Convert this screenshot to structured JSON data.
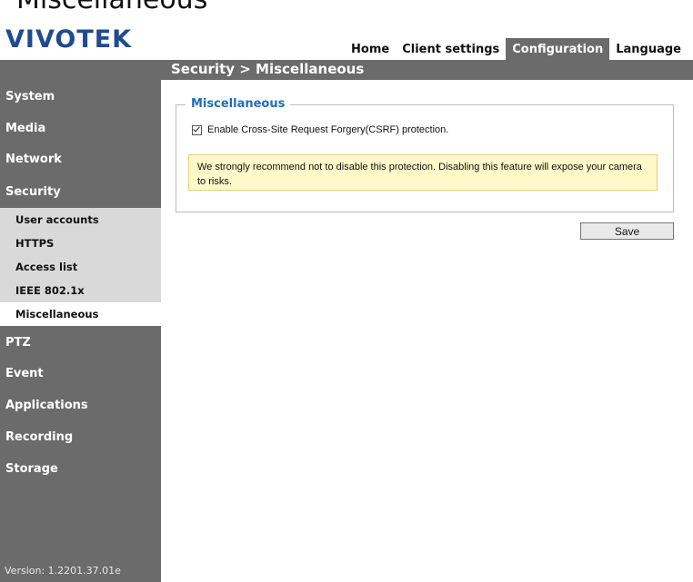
{
  "page_heading": "Miscellaneous",
  "logo": "VIVOTEK",
  "topnav": {
    "home": "Home",
    "client_settings": "Client settings",
    "configuration": "Configuration",
    "language": "Language"
  },
  "breadcrumb": "Security  > Miscellaneous",
  "sidebar": {
    "items": [
      "System",
      "Media",
      "Network",
      "Security",
      "PTZ",
      "Event",
      "Applications",
      "Recording",
      "Storage"
    ],
    "sub_items": [
      "User accounts",
      "HTTPS",
      "Access list",
      "IEEE 802.1x",
      "Miscellaneous"
    ],
    "active_sub_item": "Miscellaneous"
  },
  "version": "Version: 1.2201.37.01e",
  "panel": {
    "legend": "Miscellaneous",
    "csrf_label": "Enable Cross-Site Request Forgery(CSRF) protection.",
    "csrf_checked": true,
    "warning": "We strongly recommend not to disable this protection. Disabling this feature will expose your camera to risks."
  },
  "save_label": "Save",
  "colors": {
    "nav_bar": "#6b6b6b",
    "submenu": "#d9d9d9",
    "legend": "#1d6fb8",
    "logo": "#1f4b91",
    "warning_bg": "#fff8c9"
  }
}
